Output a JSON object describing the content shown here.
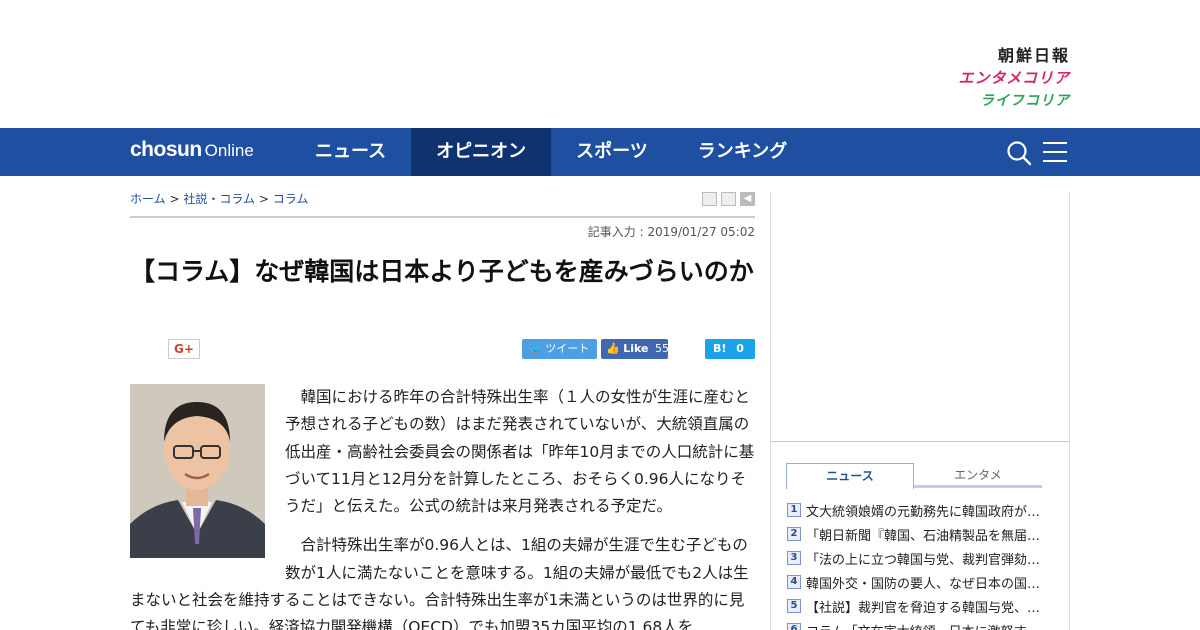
{
  "brand": {
    "chosun": "朝鮮日報",
    "entame": "エンタメコリア",
    "life": "ライフコリア"
  },
  "nav": {
    "logo_main": "chosun",
    "logo_sub": "Online",
    "items": [
      {
        "label": "ニュース",
        "active": false
      },
      {
        "label": "オピニオン",
        "active": true
      },
      {
        "label": "スポーツ",
        "active": false
      },
      {
        "label": "ランキング",
        "active": false
      }
    ],
    "search_icon": "search-icon",
    "menu_icon": "hamburger-icon"
  },
  "article": {
    "breadcrumb": {
      "home": "ホーム",
      "sep": ">",
      "section": "社説・コラム",
      "sub": "コラム"
    },
    "date": "記事入力 : 2019/01/27 05:02",
    "title": "【コラム】なぜ韓国は日本より子どもを産みづらいのか",
    "share": {
      "gplus": "G+",
      "tweet": "ツイート",
      "like": "Like",
      "like_count": "55",
      "hatena": "B!",
      "hatena_count": "0"
    },
    "paragraphs": [
      "韓国における昨年の合計特殊出生率（１人の女性が生涯に産むと予想される子どもの数）はまだ発表されていないが、大統領直属の低出産・高齢社会委員会の関係者は「昨年10月までの人口統計に基づいて11月と12月分を計算したところ、おそらく0.96人になりそうだ」と伝えた。公式の統計は来月発表される予定だ。",
      "合計特殊出生率が0.96人とは、1組の夫婦が生涯で生む子どもの数が1人に満たないことを意味する。1組の夫婦が最低でも2人は生まないと社会を維持することはできない。合計特殊出生率が1未満というのは世界的に見ても非常に珍しい。経済協力開発機構（OECD）でも加盟35カ国平均の1.68人を"
    ]
  },
  "sidebar": {
    "tabs": [
      {
        "label": "ニュース",
        "active": true
      },
      {
        "label": "エンタメ",
        "active": false
      }
    ],
    "news": [
      {
        "num": "1",
        "text": "文大統領娘婿の元勤務先に韓国政府が…"
      },
      {
        "num": "2",
        "text": "「朝日新聞『韓国、石油精製品を無届…"
      },
      {
        "num": "3",
        "text": "「法の上に立つ韓国与党、裁判官弾劾…"
      },
      {
        "num": "4",
        "text": "韓国外交・国防の要人、なぜ日本の国…"
      },
      {
        "num": "5",
        "text": "【社説】裁判官を脅迫する韓国与党、…"
      },
      {
        "num": "6",
        "text": "コラム「文在寅大統領、日本に激怒す…"
      }
    ]
  }
}
